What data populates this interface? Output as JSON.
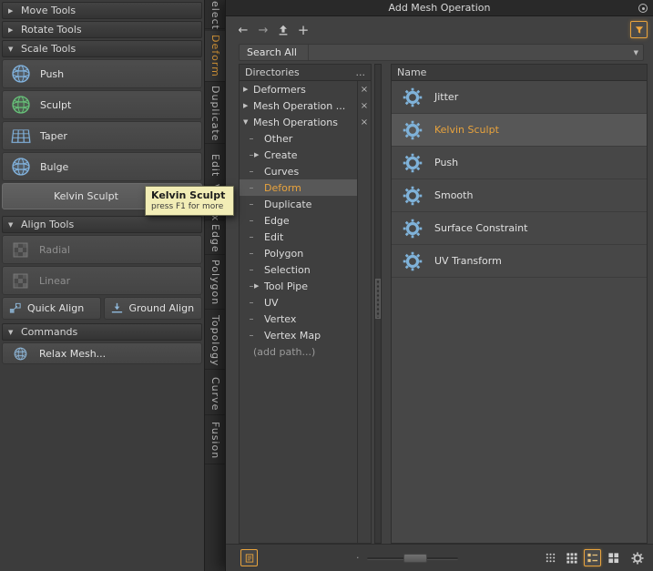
{
  "colors": {
    "accent": "#e8a33d",
    "gear_blue": "#7fb2d9"
  },
  "icons": {
    "tri_right": "▶",
    "tri_down": "▼",
    "back": "←",
    "forward": "→",
    "plus": "+",
    "close": "×",
    "dropdown": "▼",
    "dot": "·"
  },
  "left_panel": {
    "headers": {
      "move": "Move Tools",
      "rotate": "Rotate Tools",
      "scale": "Scale Tools",
      "align": "Align Tools",
      "commands": "Commands"
    },
    "tools": {
      "push": "Push",
      "sculpt": "Sculpt",
      "taper": "Taper",
      "bulge": "Bulge",
      "kelvin": "Kelvin Sculpt"
    },
    "align": {
      "radial": "Radial",
      "linear": "Linear",
      "quick": "Quick Align",
      "ground": "Ground Align"
    },
    "commands": {
      "relax": "Relax Mesh..."
    }
  },
  "tab_strip": {
    "tabs": [
      {
        "label": "Select"
      },
      {
        "label": "Deform"
      },
      {
        "label": "Duplicate"
      },
      {
        "label": "Edit"
      },
      {
        "label": "Vertex"
      },
      {
        "label": "Edge"
      },
      {
        "label": "Polygon"
      },
      {
        "label": "Topology"
      },
      {
        "label": "Curve"
      },
      {
        "label": "Fusion"
      }
    ]
  },
  "tooltip": {
    "title": "Kelvin Sculpt",
    "subtitle": "press F1 for more"
  },
  "dialog": {
    "title": "Add Mesh Operation",
    "search": {
      "label": "Search All"
    },
    "directories": {
      "header": "Directories",
      "header_more": "...",
      "rows": [
        {
          "arrow": "▶",
          "label": "Deformers"
        },
        {
          "arrow": "▶",
          "label": "Mesh Operation ..."
        },
        {
          "arrow": "▼",
          "label": "Mesh Operations"
        },
        {
          "label": "Other"
        },
        {
          "arrow": "▶",
          "label": "Create"
        },
        {
          "label": "Curves"
        },
        {
          "label": "Deform"
        },
        {
          "label": "Duplicate"
        },
        {
          "label": "Edge"
        },
        {
          "label": "Edit"
        },
        {
          "label": "Polygon"
        },
        {
          "label": "Selection"
        },
        {
          "arrow": "▶",
          "label": "Tool Pipe"
        },
        {
          "label": "UV"
        },
        {
          "label": "Vertex"
        },
        {
          "label": "Vertex Map"
        },
        {
          "label": "(add path...)"
        }
      ]
    },
    "results": {
      "header": "Name",
      "rows": [
        {
          "label": "Jitter"
        },
        {
          "label": "Kelvin Sculpt"
        },
        {
          "label": "Push"
        },
        {
          "label": "Smooth"
        },
        {
          "label": "Surface Constraint"
        },
        {
          "label": "UV Transform"
        }
      ]
    }
  }
}
